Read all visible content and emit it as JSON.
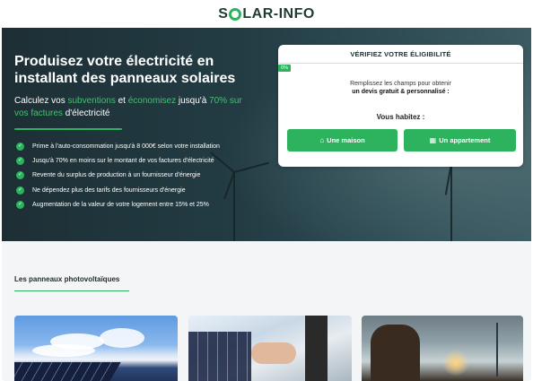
{
  "header": {
    "logo_left": "S",
    "logo_right": "LAR-INFO"
  },
  "hero": {
    "title": "Produisez votre électricité en installant des panneaux solaires",
    "subtitle_parts": {
      "p1": "Calculez vos ",
      "subventions": "subventions",
      "p2": " et ",
      "economisez": "économisez",
      "p3": " jusqu'à ",
      "percent": "70% sur vos factures",
      "p4": " d'électricité"
    },
    "features": [
      {
        "text": "Prime à l'auto-consommation jusqu'à 8 000€ selon votre installation"
      },
      {
        "text": "Jusqu'à 70% en moins sur le montant de vos factures d'électricité"
      },
      {
        "text": "Revente du surplus de production à un fournisseur d'énergie"
      },
      {
        "text": "Ne dépendez plus des tarifs des fournisseurs d'énergie"
      },
      {
        "text": "Augmentation de la valeur de votre logement entre 15% et 25%"
      }
    ]
  },
  "eligibility_card": {
    "title": "VÉRIFIEZ VOTRE ÉLIGIBILITÉ",
    "progress_label": "0%",
    "progress_value": 0,
    "text_line1": "Remplissez les champs pour obtenir",
    "text_line2": "un devis gratuit & personnalisé :",
    "question": "Vous habitez :",
    "option_house": "Une maison",
    "option_apartment": "Un appartement"
  },
  "section": {
    "title": "Les panneaux photovoltaïques"
  },
  "colors": {
    "accent": "#2db35d",
    "hero_bg": "#1d2f35",
    "section_bg": "#f4f5f6"
  },
  "icons": {
    "check": "check-icon",
    "house": "house-icon",
    "building": "building-icon",
    "sun": "sun-logo-icon"
  }
}
